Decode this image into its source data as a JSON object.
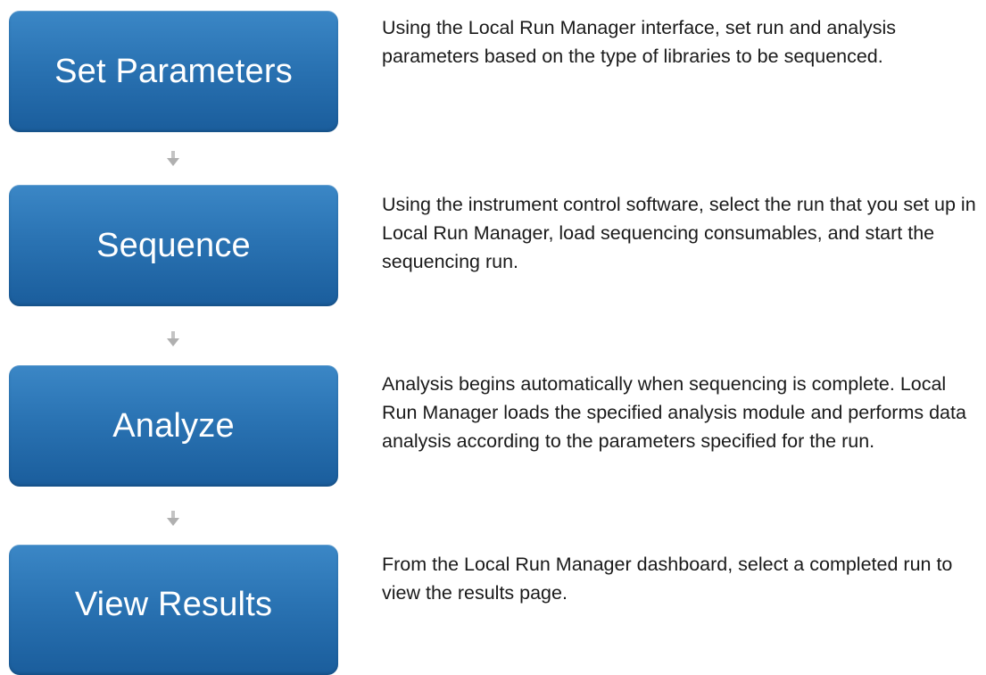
{
  "steps": [
    {
      "label": "Set Parameters",
      "description": "Using the Local Run Manager interface, set run and analysis parameters based on the type of libraries to be sequenced."
    },
    {
      "label": "Sequence",
      "description": "Using the instrument control software, select the run that you set up in Local Run Manager, load sequencing consumables, and start the sequencing run."
    },
    {
      "label": "Analyze",
      "description": "Analysis begins automatically when sequencing is complete. Local Run Manager loads the specified analysis module and performs data analysis according to the parameters specified for the run."
    },
    {
      "label": "View Results",
      "description": "From the Local Run Manager dashboard, select a completed run to view the results page."
    }
  ],
  "colors": {
    "box_top": "#3b87c6",
    "box_bottom": "#1a5d9c",
    "arrow": "#b8b8b8",
    "text": "#1a1a1a"
  },
  "icons": {
    "connector": "down-arrow-icon"
  }
}
